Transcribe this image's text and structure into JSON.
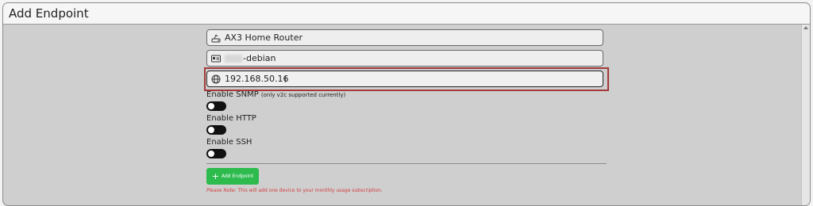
{
  "panel": {
    "title": "Add Endpoint"
  },
  "form": {
    "device_name": {
      "value": "AX3 Home Router",
      "icon": "router-icon"
    },
    "host_name": {
      "value_suffix": "-debian",
      "icon": "id-card-icon"
    },
    "ip_address": {
      "value": "192.168.50.16",
      "icon": "globe-icon"
    },
    "snmp": {
      "label": "Enable SNMP",
      "note": "(only v2c supported currently)",
      "enabled": false
    },
    "http": {
      "label": "Enable HTTP",
      "enabled": false
    },
    "ssh": {
      "label": "Enable SSH",
      "enabled": false
    },
    "add_button": {
      "label": "Add Endpoint",
      "color": "#2dbb4e"
    },
    "footer_note": {
      "prefix": "Please Note:",
      "text": " This will add one device to your monthly usage subscription.",
      "color": "#d23c3c"
    }
  }
}
